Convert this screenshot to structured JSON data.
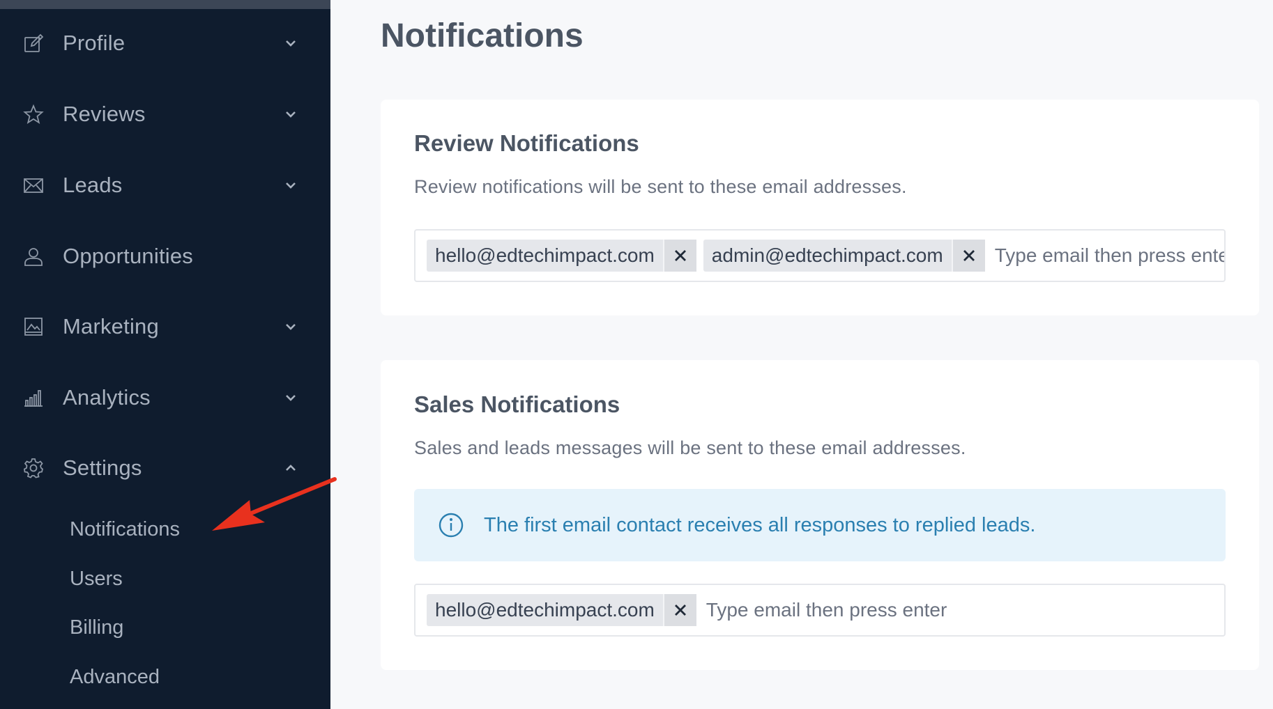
{
  "sidebar": {
    "items": [
      {
        "label": "Profile",
        "icon": "edit-icon",
        "chevron": "down"
      },
      {
        "label": "Reviews",
        "icon": "star-icon",
        "chevron": "down"
      },
      {
        "label": "Leads",
        "icon": "envelope-icon",
        "chevron": "down"
      },
      {
        "label": "Opportunities",
        "icon": "user-icon",
        "chevron": "none"
      },
      {
        "label": "Marketing",
        "icon": "image-icon",
        "chevron": "down"
      },
      {
        "label": "Analytics",
        "icon": "bar-chart-icon",
        "chevron": "down"
      },
      {
        "label": "Settings",
        "icon": "gear-icon",
        "chevron": "up"
      }
    ],
    "settings_subitems": [
      {
        "label": "Notifications"
      },
      {
        "label": "Users"
      },
      {
        "label": "Billing"
      },
      {
        "label": "Advanced"
      }
    ]
  },
  "page": {
    "title": "Notifications"
  },
  "review_card": {
    "title": "Review Notifications",
    "description": "Review notifications will be sent to these email addresses.",
    "emails": [
      "hello@edtechimpact.com",
      "admin@edtechimpact.com"
    ],
    "placeholder": "Type email then press enter"
  },
  "sales_card": {
    "title": "Sales Notifications",
    "description": "Sales and leads messages will be sent to these email addresses.",
    "info": "The first email contact receives all responses to replied leads.",
    "emails": [
      "hello@edtechimpact.com"
    ],
    "placeholder": "Type email then press enter"
  },
  "colors": {
    "sidebar_bg": "#0f1c2e",
    "page_bg": "#f7f8fa",
    "info_bg": "#e6f3fb",
    "info_text": "#2a7fb0",
    "annotation_arrow": "#e8311e"
  }
}
